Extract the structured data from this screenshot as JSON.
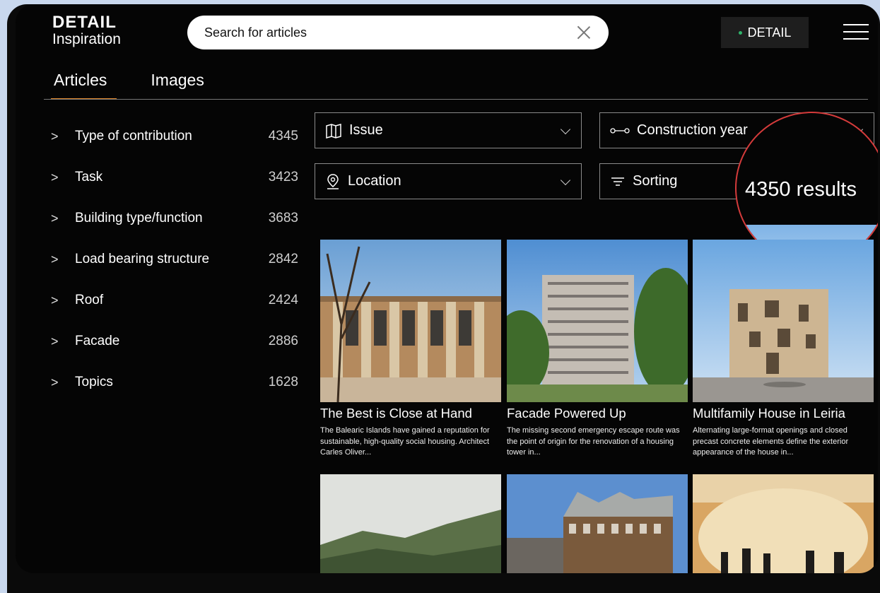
{
  "header": {
    "brand": "DETAIL",
    "brand_sub": "Inspiration",
    "search_placeholder": "Search for articles",
    "detail_button": "DETAIL",
    "clear_icon": "close-icon",
    "menu_icon": "hamburger-menu-icon"
  },
  "tabs": [
    {
      "label": "Articles",
      "active": true
    },
    {
      "label": "Images",
      "active": false
    }
  ],
  "facets": [
    {
      "label": "Type of contribution",
      "count": "4345"
    },
    {
      "label": "Task",
      "count": "3423"
    },
    {
      "label": "Building type/function",
      "count": "3683"
    },
    {
      "label": "Load bearing structure",
      "count": "2842"
    },
    {
      "label": "Roof",
      "count": "2424"
    },
    {
      "label": "Facade",
      "count": "2886"
    },
    {
      "label": "Topics",
      "count": "1628"
    }
  ],
  "filters": {
    "issue": "Issue",
    "construction_year": "Construction year",
    "location": "Location",
    "sorting": "Sorting"
  },
  "results": {
    "count_text": "4350 results"
  },
  "articles": [
    {
      "title": "The Best is Close at Hand",
      "desc": "The Balearic Islands have gained a reputation for sustainable, high-quality social housing. Architect Carles Oliver..."
    },
    {
      "title": "Facade Powered Up",
      "desc": "The missing second emergency escape route was the point of origin for the renovation of a housing tower in..."
    },
    {
      "title": "Multifamily House in Leiria",
      "desc": "Alternating large-format openings and closed precast concrete elements define the exterior appearance of the house in..."
    }
  ],
  "colors": {
    "accent": "#e0872a",
    "highlight_circle": "#d53b3b",
    "detail_dot": "#2fb36a"
  }
}
